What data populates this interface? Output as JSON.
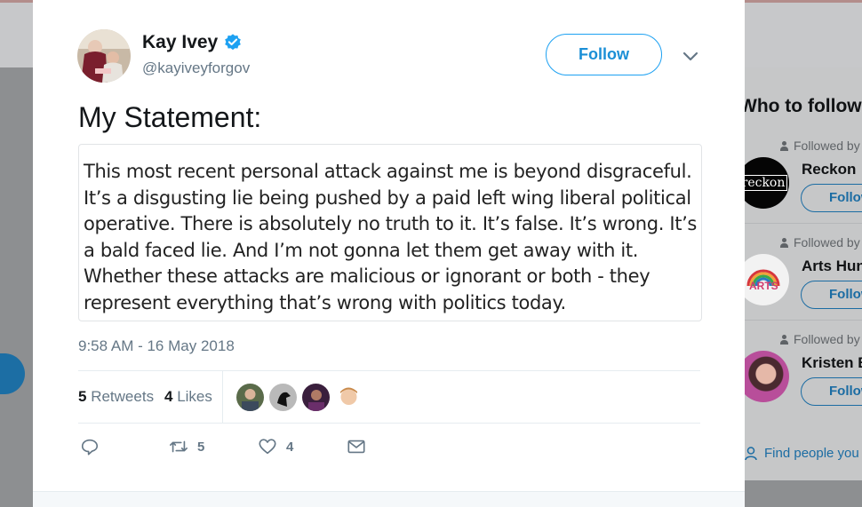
{
  "author": {
    "name": "Kay Ivey",
    "handle": "@kayiveyforgov",
    "follow_label": "Follow"
  },
  "tweet": {
    "text": "My Statement:",
    "statement_lines": [
      "This most recent personal attack against me is beyond disgraceful.",
      "It’s a disgusting lie being pushed by a paid left wing liberal political",
      "operative. There is absolutely no truth to it. It’s false. It’s wrong. It’s",
      "a bald faced lie. And I’m not gonna let them get away with it.",
      "Whether these attacks are malicious or ignorant or both - they",
      "represent everything that’s wrong with politics today."
    ],
    "timestamp": "9:58 AM - 16 May 2018"
  },
  "stats": {
    "retweets_count": "5",
    "retweets_label": "Retweets",
    "likes_count": "4",
    "likes_label": "Likes"
  },
  "actions": {
    "retweet_count": "5",
    "like_count": "4"
  },
  "sidebar": {
    "title": "Who to follow",
    "followed_by": "Followed by",
    "follow_label": "Follow",
    "suggestions": [
      {
        "name": "Reckon",
        "avatar_text": "reckon"
      },
      {
        "name": "Arts Hunt",
        "avatar_text": "ARTS"
      },
      {
        "name": "Kristen B"
      }
    ],
    "find_people": "Find people you know"
  },
  "colors": {
    "accent": "#1da1f2",
    "verified": "#1da1f2",
    "muted_text": "#657786"
  }
}
